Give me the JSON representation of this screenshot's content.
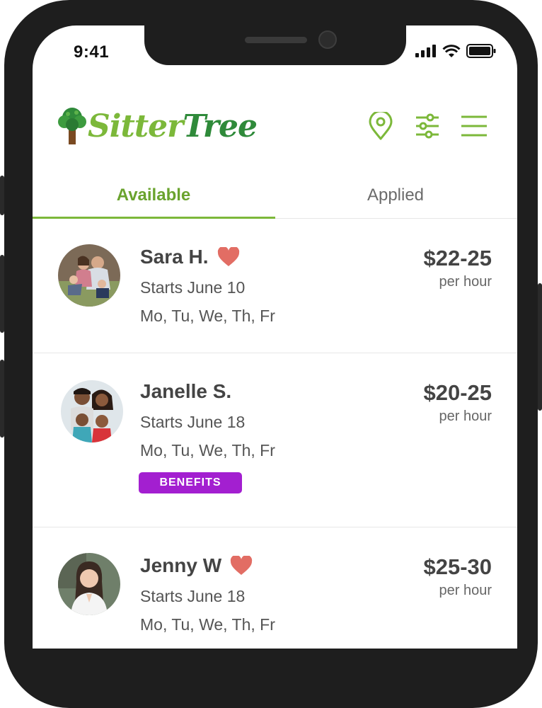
{
  "status_bar": {
    "time": "9:41"
  },
  "header": {
    "logo": {
      "part1": "Sitter",
      "part2": "Tree"
    },
    "icons": [
      "location-pin-icon",
      "filter-sliders-icon",
      "menu-icon"
    ],
    "accent_color": "#7cb83a"
  },
  "tabs": [
    {
      "label": "Available",
      "active": true
    },
    {
      "label": "Applied",
      "active": false
    }
  ],
  "jobs": [
    {
      "name": "Sara H.",
      "favorite": true,
      "start": "Starts June 10",
      "days": "Mo, Tu, We, Th, Fr",
      "price": "$22-25",
      "per": "per hour"
    },
    {
      "name": "Janelle S.",
      "favorite": false,
      "start": "Starts June 18",
      "days": "Mo, Tu, We, Th, Fr",
      "price": "$20-25",
      "per": "per hour",
      "badge": "BENEFITS"
    },
    {
      "name": "Jenny W",
      "favorite": true,
      "start": "Starts June 18",
      "days": "Mo, Tu, We, Th, Fr",
      "price": "$25-30",
      "per": "per hour"
    }
  ]
}
